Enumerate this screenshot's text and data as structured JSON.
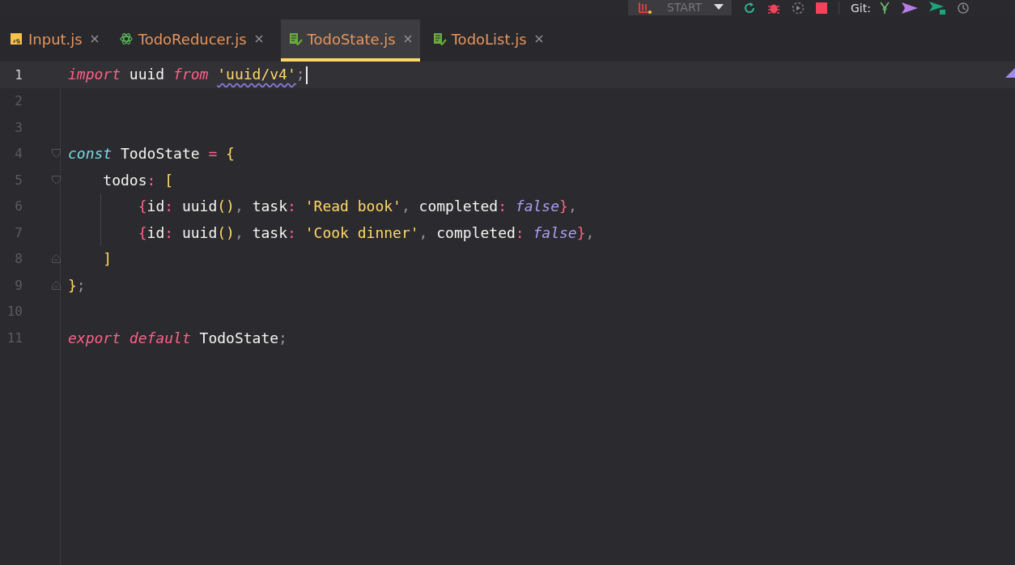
{
  "toolbar": {
    "run_config": {
      "label": "START"
    },
    "git_label": "Git:"
  },
  "tabs": [
    {
      "label": "Input.js",
      "kind": "js",
      "selected": false
    },
    {
      "label": "TodoReducer.js",
      "kind": "react",
      "selected": false
    },
    {
      "label": "TodoState.js",
      "kind": "checked-file",
      "selected": true
    },
    {
      "label": "TodoList.js",
      "kind": "checked-file",
      "selected": false
    }
  ],
  "editor": {
    "lines": [
      {
        "number": "1",
        "current": true,
        "fold_open": false,
        "fold_close": false,
        "tokens": [
          {
            "text": "import ",
            "kind": "keyword"
          },
          {
            "text": "uuid ",
            "kind": "ident"
          },
          {
            "text": "from ",
            "kind": "keyword"
          },
          {
            "text": "'uuid/v4'",
            "kind": "string-warn"
          },
          {
            "text": ";",
            "kind": "punct"
          }
        ]
      },
      {
        "number": "2",
        "current": false,
        "fold_open": false,
        "fold_close": false
      },
      {
        "number": "3",
        "current": false,
        "fold_open": false,
        "fold_close": false
      },
      {
        "number": "4",
        "current": false,
        "fold_open": true,
        "fold_close": false,
        "tokens": [
          {
            "text": "const ",
            "kind": "storage"
          },
          {
            "text": "TodoState ",
            "kind": "ident"
          },
          {
            "text": "= ",
            "kind": "op"
          },
          {
            "text": "{",
            "kind": "bracket"
          }
        ]
      },
      {
        "number": "5",
        "current": false,
        "fold_open": true,
        "fold_close": false,
        "tokens": [
          {
            "text": "    todos",
            "kind": "ident"
          },
          {
            "text": ": ",
            "kind": "op"
          },
          {
            "text": "[",
            "kind": "bracket"
          }
        ]
      },
      {
        "number": "6",
        "current": false,
        "fold_open": false,
        "fold_close": false,
        "tokens": [
          {
            "text": "        {",
            "kind": "bracket2"
          },
          {
            "text": "id",
            "kind": "ident"
          },
          {
            "text": ": ",
            "kind": "op"
          },
          {
            "text": "uuid",
            "kind": "ident"
          },
          {
            "text": "()",
            "kind": "bracket"
          },
          {
            "text": ", ",
            "kind": "punct"
          },
          {
            "text": "task",
            "kind": "ident"
          },
          {
            "text": ": ",
            "kind": "op"
          },
          {
            "text": "'Read book'",
            "kind": "string"
          },
          {
            "text": ", ",
            "kind": "punct"
          },
          {
            "text": "completed",
            "kind": "ident"
          },
          {
            "text": ": ",
            "kind": "op"
          },
          {
            "text": "false",
            "kind": "bool"
          },
          {
            "text": "}",
            "kind": "bracket2"
          },
          {
            "text": ",",
            "kind": "punct"
          }
        ]
      },
      {
        "number": "7",
        "current": false,
        "fold_open": false,
        "fold_close": false,
        "tokens": [
          {
            "text": "        {",
            "kind": "bracket2"
          },
          {
            "text": "id",
            "kind": "ident"
          },
          {
            "text": ": ",
            "kind": "op"
          },
          {
            "text": "uuid",
            "kind": "ident"
          },
          {
            "text": "()",
            "kind": "bracket"
          },
          {
            "text": ", ",
            "kind": "punct"
          },
          {
            "text": "task",
            "kind": "ident"
          },
          {
            "text": ": ",
            "kind": "op"
          },
          {
            "text": "'Cook dinner'",
            "kind": "string"
          },
          {
            "text": ", ",
            "kind": "punct"
          },
          {
            "text": "completed",
            "kind": "ident"
          },
          {
            "text": ": ",
            "kind": "op"
          },
          {
            "text": "false",
            "kind": "bool"
          },
          {
            "text": "}",
            "kind": "bracket2"
          },
          {
            "text": ",",
            "kind": "punct"
          }
        ]
      },
      {
        "number": "8",
        "current": false,
        "fold_open": false,
        "fold_close": true,
        "tokens": [
          {
            "text": "    ]",
            "kind": "bracket"
          }
        ]
      },
      {
        "number": "9",
        "current": false,
        "fold_open": false,
        "fold_close": true,
        "tokens": [
          {
            "text": "}",
            "kind": "bracket"
          },
          {
            "text": ";",
            "kind": "punct"
          }
        ]
      },
      {
        "number": "10",
        "current": false,
        "fold_open": false,
        "fold_close": false
      },
      {
        "number": "11",
        "current": false,
        "fold_open": false,
        "fold_close": false,
        "tokens": [
          {
            "text": "export ",
            "kind": "keyword"
          },
          {
            "text": "default ",
            "kind": "keyword"
          },
          {
            "text": "TodoState",
            "kind": "ident"
          },
          {
            "text": ";",
            "kind": "punct"
          }
        ]
      }
    ]
  }
}
